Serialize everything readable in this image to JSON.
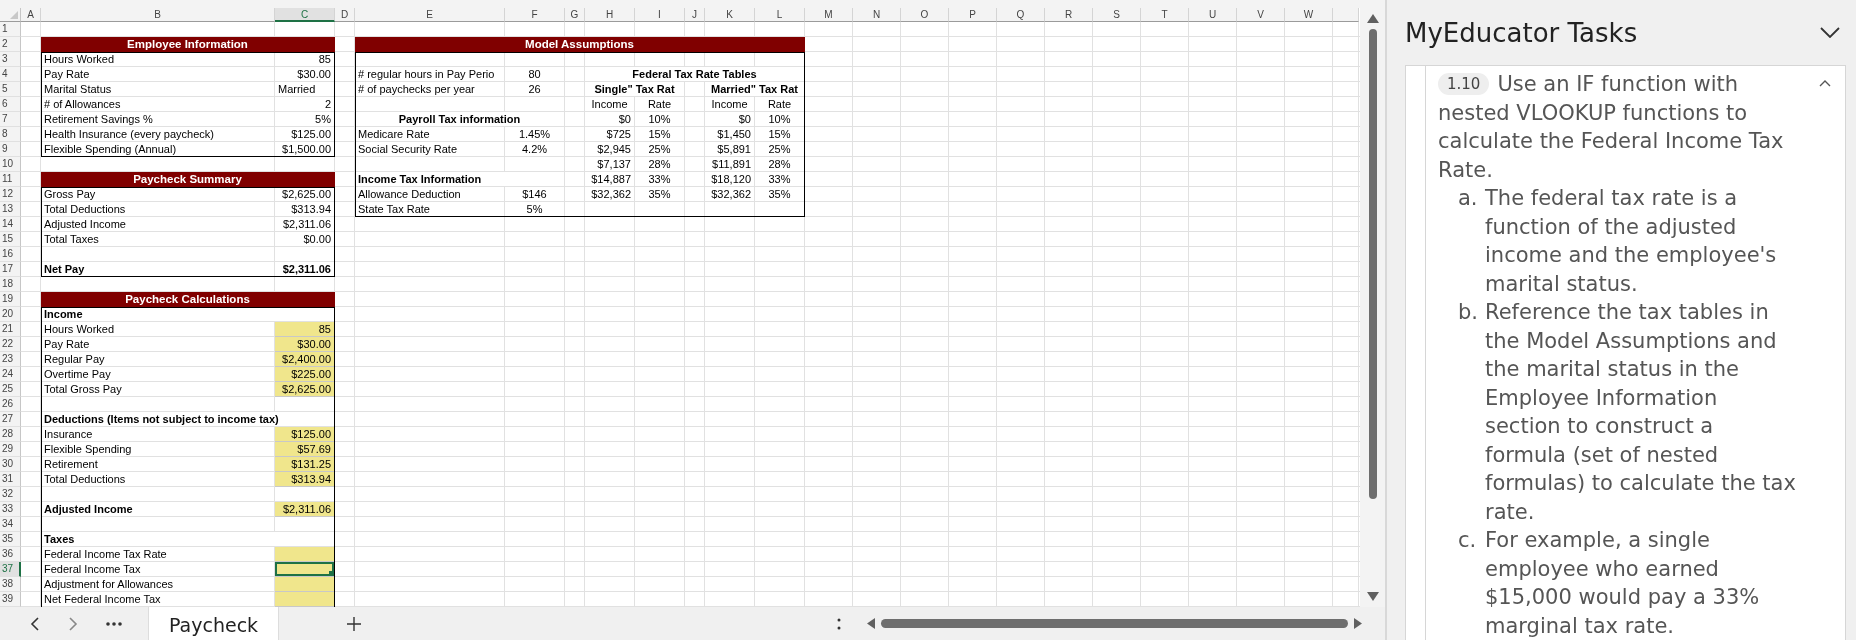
{
  "sheet": {
    "columns": [
      "A",
      "B",
      "C",
      "D",
      "E",
      "F",
      "G",
      "H",
      "I",
      "J",
      "K",
      "L",
      "M",
      "N",
      "O",
      "P",
      "Q",
      "R",
      "S",
      "T",
      "U",
      "V",
      "W"
    ],
    "rows": [
      "1",
      "2",
      "3",
      "4",
      "5",
      "6",
      "7",
      "8",
      "9",
      "10",
      "11",
      "12",
      "13",
      "14",
      "15",
      "16",
      "17",
      "18",
      "19",
      "20",
      "21",
      "22",
      "23",
      "24",
      "25",
      "26",
      "27",
      "28",
      "29",
      "30",
      "31",
      "32",
      "33",
      "34",
      "35",
      "36",
      "37",
      "38",
      "39"
    ]
  },
  "employee_information": {
    "title": "Employee Information",
    "rows": [
      {
        "label": "Hours Worked",
        "value": "85",
        "kind": "number"
      },
      {
        "label": "Pay Rate",
        "value": "$30.00",
        "kind": "number"
      },
      {
        "label": "Marital Status",
        "value": "Married",
        "kind": "text"
      },
      {
        "label": "# of Allowances",
        "value": "2",
        "kind": "number"
      },
      {
        "label": "Retirement Savings %",
        "value": "5%",
        "kind": "number"
      },
      {
        "label": "Health Insurance (every paycheck)",
        "value": "$125.00",
        "kind": "number"
      },
      {
        "label": "Flexible Spending (Annual)",
        "value": "$1,500.00",
        "kind": "number"
      }
    ]
  },
  "paycheck_summary": {
    "title": "Paycheck Summary",
    "rows": [
      {
        "label": "Gross Pay",
        "value": "$2,625.00",
        "kind": "item"
      },
      {
        "label": "Total Deductions",
        "value": "$313.94",
        "kind": "item"
      },
      {
        "label": "Adjusted Income",
        "value": "$2,311.06",
        "kind": "item"
      },
      {
        "label": "Total Taxes",
        "value": "$0.00",
        "kind": "item"
      },
      {
        "label": "Net Pay",
        "value": "$2,311.06",
        "kind": "total"
      }
    ]
  },
  "paycheck_calculations": {
    "title": "Paycheck Calculations",
    "groups": [
      {
        "heading": "Income",
        "items": [
          {
            "label": "Hours Worked",
            "value": "85",
            "selected": false
          },
          {
            "label": "Pay Rate",
            "value": "$30.00",
            "selected": false
          },
          {
            "label": "Regular Pay",
            "value": "$2,400.00",
            "selected": false
          },
          {
            "label": "Overtime Pay",
            "value": "$225.00",
            "selected": false
          },
          {
            "label": "Total Gross Pay",
            "value": "$2,625.00",
            "selected": false
          }
        ]
      },
      {
        "heading": "Deductions (Items not subject to income tax)",
        "items": [
          {
            "label": "Insurance",
            "value": "$125.00",
            "selected": false
          },
          {
            "label": "Flexible Spending",
            "value": "$57.69",
            "selected": false
          },
          {
            "label": "Retirement",
            "value": "$131.25",
            "selected": false
          },
          {
            "label": "Total Deductions",
            "value": "$313.94",
            "selected": false
          }
        ]
      },
      {
        "label": "Adjusted Income",
        "value": "$2,311.06",
        "selected": false
      },
      {
        "heading": "Taxes",
        "items": [
          {
            "label": "Federal Income Tax Rate",
            "selected": false
          },
          {
            "label": "Federal Income Tax",
            "selected": true
          },
          {
            "label": "Adjustment for Allowances",
            "selected": false
          },
          {
            "label": "Net Federal Income Tax",
            "selected": false
          }
        ]
      }
    ]
  },
  "model_assumptions": {
    "title": "Model Assumptions",
    "settings": [
      {
        "label": "# regular hours in Pay Perio",
        "value": "80"
      },
      {
        "label": "# of paychecks per year",
        "value": "26"
      }
    ],
    "payroll_tax": {
      "heading": "Payroll Tax information",
      "rows": [
        {
          "label": "Medicare Rate",
          "value": "1.45%"
        },
        {
          "label": "Social Security Rate",
          "value": "4.2%"
        }
      ]
    },
    "income_tax": {
      "heading": "Income Tax Information",
      "rows": [
        {
          "label": "Allowance Deduction",
          "value": "$146"
        },
        {
          "label": "State Tax Rate",
          "value": "5%"
        }
      ]
    },
    "tax_tables": {
      "title": "Federal Tax Rate Tables",
      "tables": [
        {
          "title": "Single\" Tax Rat",
          "columns": [
            "Income",
            "Rate"
          ],
          "rows": [
            [
              "$0",
              "10%"
            ],
            [
              "$725",
              "15%"
            ],
            [
              "$2,945",
              "25%"
            ],
            [
              "$7,137",
              "28%"
            ],
            [
              "$14,887",
              "33%"
            ],
            [
              "$32,362",
              "35%"
            ]
          ]
        },
        {
          "title": "Married\" Tax Rat",
          "columns": [
            "Income",
            "Rate"
          ],
          "rows": [
            [
              "$0",
              "10%"
            ],
            [
              "$1,450",
              "15%"
            ],
            [
              "$5,891",
              "25%"
            ],
            [
              "$11,891",
              "28%"
            ],
            [
              "$18,120",
              "33%"
            ],
            [
              "$32,362",
              "35%"
            ]
          ]
        }
      ]
    }
  },
  "sheet_tabs": [
    {
      "label": "Paycheck",
      "selected": true
    }
  ],
  "task_pane": {
    "title": "MyEducator Tasks",
    "task": {
      "number": "1.10",
      "text": "Use an IF function with nested VLOOKUP functions to calculate the Federal Income Tax Rate.",
      "expanded": true,
      "steps": [
        {
          "marker": "a.",
          "text": "The federal tax rate is a function of the adjusted income and the employee's marital status."
        },
        {
          "marker": "b.",
          "text": "Reference the tax tables in the Model Assumptions and the marital status in the Employee Information section to construct a formula (set of nested formulas) to calculate the tax rate."
        },
        {
          "marker": "c.",
          "text": "For example, a single employee who earned $15,000 would pay a 33% marginal tax rate."
        }
      ]
    }
  }
}
